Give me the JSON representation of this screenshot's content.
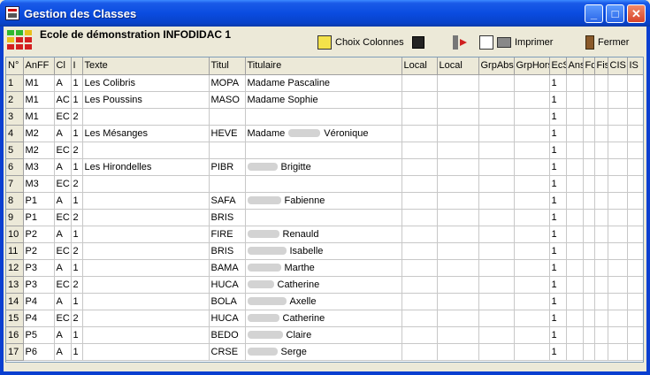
{
  "window": {
    "title": "Gestion des Classes"
  },
  "header": {
    "school_name": "Ecole de démonstration INFODIDAC 1"
  },
  "toolbar": {
    "columns_label": "Choix Colonnes",
    "print_label": "Imprimer",
    "close_label": "Fermer"
  },
  "columns": [
    "N°",
    "AnFF",
    "Cl",
    "I",
    "Texte",
    "Titul",
    "Titulaire",
    "Local",
    "Local",
    "GrpAbs",
    "GrpHors",
    "EcS",
    "Ans",
    "Fd",
    "Fis",
    "CIS",
    "IS"
  ],
  "rows": [
    {
      "n": "1",
      "anff": "M1",
      "cl": "A",
      "i": "1",
      "texte": "Les Colibris",
      "titul": "MOPA",
      "titulaire": "Madame Pascaline",
      "blurred": false,
      "ecs": "1"
    },
    {
      "n": "2",
      "anff": "M1",
      "cl": "AC",
      "i": "1",
      "texte": "Les Poussins",
      "titul": "MASO",
      "titulaire": "Madame Sophie",
      "blurred": false,
      "ecs": "1"
    },
    {
      "n": "3",
      "anff": "M1",
      "cl": "EC",
      "i": "2",
      "texte": "",
      "titul": "",
      "titulaire": "",
      "blurred": false,
      "ecs": "1"
    },
    {
      "n": "4",
      "anff": "M2",
      "cl": "A",
      "i": "1",
      "texte": "Les Mésanges",
      "titul": "HEVE",
      "titulaire": "Véronique",
      "prefix": "Madame",
      "blurred": true,
      "ecs": "1"
    },
    {
      "n": "5",
      "anff": "M2",
      "cl": "EC",
      "i": "2",
      "texte": "",
      "titul": "",
      "titulaire": "",
      "blurred": false,
      "ecs": "1"
    },
    {
      "n": "6",
      "anff": "M3",
      "cl": "A",
      "i": "1",
      "texte": "Les Hirondelles",
      "titul": "PIBR",
      "titulaire": "Brigitte",
      "blurred": true,
      "ecs": "1"
    },
    {
      "n": "7",
      "anff": "M3",
      "cl": "EC",
      "i": "2",
      "texte": "",
      "titul": "",
      "titulaire": "",
      "blurred": false,
      "ecs": "1"
    },
    {
      "n": "8",
      "anff": "P1",
      "cl": "A",
      "i": "1",
      "texte": "",
      "titul": "SAFA",
      "titulaire": "Fabienne",
      "blurred": true,
      "ecs": "1"
    },
    {
      "n": "9",
      "anff": "P1",
      "cl": "EC",
      "i": "2",
      "texte": "",
      "titul": "BRIS",
      "titulaire": "",
      "blurred": false,
      "ecs": "1"
    },
    {
      "n": "10",
      "anff": "P2",
      "cl": "A",
      "i": "1",
      "texte": "",
      "titul": "FIRE",
      "titulaire": "Renauld",
      "blurred": true,
      "ecs": "1"
    },
    {
      "n": "11",
      "anff": "P2",
      "cl": "EC",
      "i": "2",
      "texte": "",
      "titul": "BRIS",
      "titulaire": "Isabelle",
      "blurred": true,
      "ecs": "1"
    },
    {
      "n": "12",
      "anff": "P3",
      "cl": "A",
      "i": "1",
      "texte": "",
      "titul": "BAMA",
      "titulaire": "Marthe",
      "blurred": true,
      "ecs": "1"
    },
    {
      "n": "13",
      "anff": "P3",
      "cl": "EC",
      "i": "2",
      "texte": "",
      "titul": "HUCA",
      "titulaire": "Catherine",
      "blurred": true,
      "ecs": "1"
    },
    {
      "n": "14",
      "anff": "P4",
      "cl": "A",
      "i": "1",
      "texte": "",
      "titul": "BOLA",
      "titulaire": "Axelle",
      "blurred": true,
      "ecs": "1"
    },
    {
      "n": "15",
      "anff": "P4",
      "cl": "EC",
      "i": "2",
      "texte": "",
      "titul": "HUCA",
      "titulaire": "Catherine",
      "blurred": true,
      "ecs": "1"
    },
    {
      "n": "16",
      "anff": "P5",
      "cl": "A",
      "i": "1",
      "texte": "",
      "titul": "BEDO",
      "titulaire": "Claire",
      "blurred": true,
      "ecs": "1"
    },
    {
      "n": "17",
      "anff": "P6",
      "cl": "A",
      "i": "1",
      "texte": "",
      "titul": "CRSE",
      "titulaire": "Serge",
      "blurred": true,
      "ecs": "1"
    }
  ]
}
